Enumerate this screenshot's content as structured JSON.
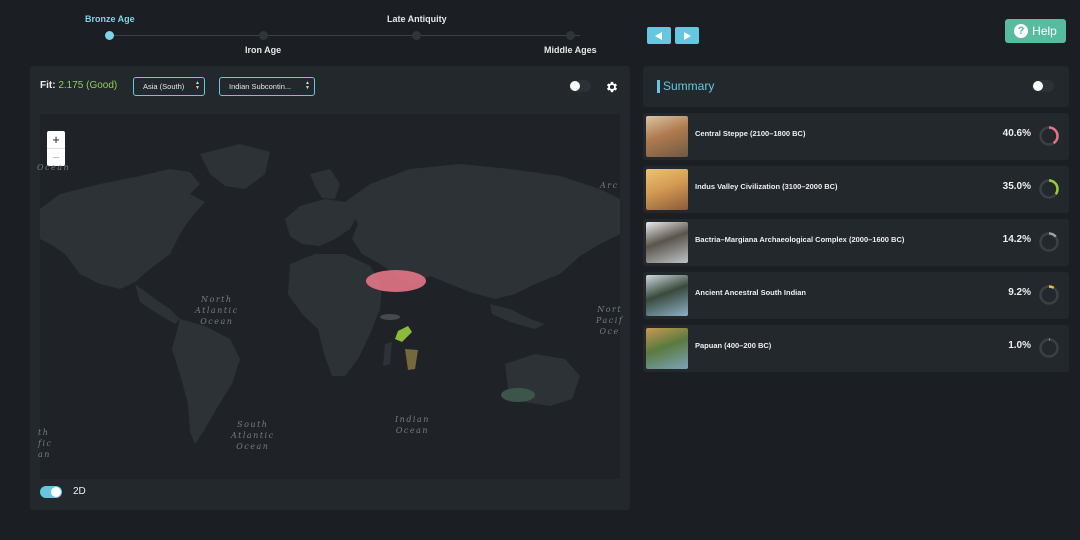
{
  "timeline": {
    "periods": [
      {
        "label": "Bronze Age",
        "active": true
      },
      {
        "label": "Iron Age",
        "active": false
      },
      {
        "label": "Late Antiquity",
        "active": false
      },
      {
        "label": "Middle Ages",
        "active": false
      }
    ]
  },
  "nav": {
    "prev_icon": "triangle-left-icon",
    "next_icon": "triangle-right-icon"
  },
  "help": {
    "label": "Help",
    "icon": "question-icon"
  },
  "map": {
    "fit_label": "Fit:",
    "fit_value": "2.175 (Good)",
    "region_select": "Asia (South)",
    "population_select": "Indian Subcontin...",
    "toggle_on": false,
    "zoom_in": "+",
    "zoom_out": "−",
    "labels": {
      "ocean_topleft": "Ocean",
      "arctic": "Arc",
      "north_atlantic": "North\nAtlantic\nOcean",
      "north_pacific": "Nort\nPacif\nOce",
      "south_atlantic": "South\nAtlantic\nOcean",
      "indian_ocean": "Indian\nOcean",
      "south_pacific_fragment": "th\nfic\nan"
    },
    "mode_label": "2D",
    "mode_2d_on": true
  },
  "summary": {
    "title": "Summary",
    "toggle_on": false,
    "rows": [
      {
        "name": "Central Steppe (2100–1800 BC)",
        "percent": "40.6%",
        "value": 0.406,
        "color": "#e37586"
      },
      {
        "name": "Indus Valley Civilization (3100–2000 BC)",
        "percent": "35.0%",
        "value": 0.35,
        "color": "#98cc3f"
      },
      {
        "name": "Bactria–Margiana Archaeological Complex (2000–1600 BC)",
        "percent": "14.2%",
        "value": 0.142,
        "color": "#9aa1a6"
      },
      {
        "name": "Ancient Ancestral South Indian",
        "percent": "9.2%",
        "value": 0.092,
        "color": "#e5c04a"
      },
      {
        "name": "Papuan (400–200 BC)",
        "percent": "1.0%",
        "value": 0.01,
        "color": "#c9ced2"
      }
    ]
  },
  "colors": {
    "accent": "#66c7e0",
    "help_button": "#57bb9e",
    "fit_good": "#8fcf52"
  }
}
